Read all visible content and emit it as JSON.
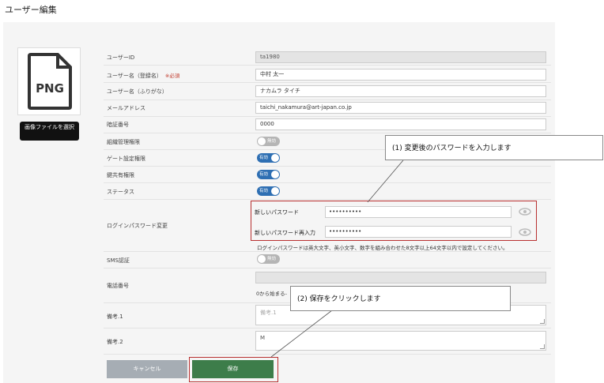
{
  "page": {
    "title": "ユーザー編集"
  },
  "avatar": {
    "file_badge": "PNG",
    "upload_label": "画像ファイルを選択"
  },
  "form": {
    "user_id": {
      "label": "ユーザーID",
      "value": "ta1980"
    },
    "name": {
      "label": "ユーザー名（登録名）",
      "required": "※必須",
      "value": "中村 太一"
    },
    "kana": {
      "label": "ユーザー名（ふりがな）",
      "value": "ナカムラ タイチ"
    },
    "email": {
      "label": "メールアドレス",
      "value": "taichi_nakamura@art-japan.co.jp"
    },
    "pin": {
      "label": "暗証番号",
      "value": "0000"
    },
    "org_admin": {
      "label": "組織管理権限",
      "state": "無効"
    },
    "gate_settings": {
      "label": "ゲート設定権限",
      "state": "有効"
    },
    "key_share": {
      "label": "鍵共有権限",
      "state": "有効"
    },
    "status": {
      "label": "ステータス",
      "state": "有効"
    },
    "password_change": {
      "label": "ログインパスワード変更",
      "new_label": "新しいパスワード",
      "new_value": "••••••••••",
      "confirm_label": "新しいパスワード再入力",
      "confirm_value": "••••••••••",
      "hint": "ログインパスワードは英大文字、英小文字、数字を組み合わせた8文字以上64文字以内で設定してください。"
    },
    "sms": {
      "label": "SMS認証",
      "state": "無効"
    },
    "phone": {
      "label": "電話番号",
      "value": "",
      "hint": "0から始まる-"
    },
    "note1": {
      "label": "備考.1",
      "placeholder": "備考.1"
    },
    "note2": {
      "label": "備考.2",
      "value": "M"
    }
  },
  "buttons": {
    "cancel": "キャンセル",
    "save": "保存"
  },
  "callouts": {
    "step1": "(1) 変更後のパスワードを入力します",
    "step2": "(2) 保存をクリックします"
  },
  "colors": {
    "highlight": "#b83030",
    "toggle_on": "#2e6fb3",
    "toggle_off": "#b5b5b5",
    "save": "#3d7d4a",
    "cancel": "#a6adb4"
  }
}
